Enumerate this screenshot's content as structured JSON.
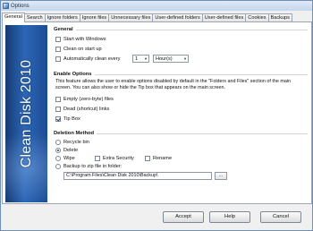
{
  "window": {
    "title": "Options"
  },
  "tabs": [
    {
      "label": "General",
      "active": true
    },
    {
      "label": "Search"
    },
    {
      "label": "Ignore folders"
    },
    {
      "label": "Ignore files"
    },
    {
      "label": "Unnecessary files"
    },
    {
      "label": "User-defined folders"
    },
    {
      "label": "User-defined files"
    },
    {
      "label": "Cookies"
    },
    {
      "label": "Backups"
    }
  ],
  "banner": {
    "text": "Clean Disk 2010"
  },
  "general": {
    "title": "General",
    "start_with_windows": {
      "label": "Start with Windows",
      "checked": false
    },
    "clean_on_startup": {
      "label": "Clean on start up",
      "checked": false
    },
    "auto_clean": {
      "label": "Automatically clean every",
      "checked": false,
      "value": "1",
      "unit": "Hour(s)"
    }
  },
  "enable_options": {
    "title": "Enable Options",
    "description": "This feature allows the user to enable options disabled by default in the \"Folders and Files\" section of the main screen. You can also show or hide the Tip box that appears on the main screen.",
    "empty_files": {
      "label": "Empty (zero-byte) files",
      "checked": false
    },
    "dead_links": {
      "label": "Dead (shortcut) links",
      "checked": false
    },
    "tip_box": {
      "label": "Tip Box",
      "checked": true
    }
  },
  "deletion": {
    "title": "Deletion Method",
    "recycle_bin": "Recycle bin",
    "delete": "Delete",
    "wipe": "Wipe",
    "extra_security": "Extra Security",
    "rename": "Rename",
    "backup_zip": "Backup to zip file in folder:",
    "selected": "delete",
    "backup_path": "C:\\Program Files\\Clean Disk 2010\\Backup\\",
    "browse": "..."
  },
  "buttons": {
    "accept": "Accept",
    "help": "Help",
    "cancel": "Cancel"
  }
}
